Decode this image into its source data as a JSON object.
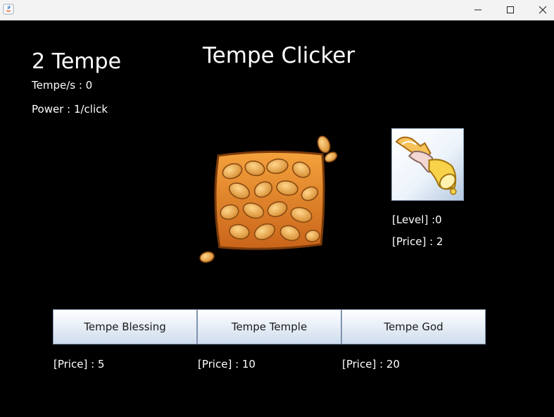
{
  "window": {
    "icon": "java-icon",
    "minimize_icon": "minimize-icon",
    "maximize_icon": "maximize-icon",
    "close_icon": "close-icon"
  },
  "stats": {
    "tempe_count": "2 Tempe",
    "tempe_per_second": "Tempe/s : 0",
    "power": "Power : 1/click"
  },
  "game": {
    "title": "Tempe Clicker",
    "clicker_icon": "tempe-icon"
  },
  "upgrade": {
    "icon": "hand-bell-icon",
    "level": "[Level] :0",
    "price": "[Price] : 2"
  },
  "shop": {
    "items": [
      {
        "label": "Tempe Blessing",
        "price": "[Price] : 5"
      },
      {
        "label": "Tempe Temple",
        "price": "[Price] : 10"
      },
      {
        "label": "Tempe God",
        "price": "[Price] : 20"
      }
    ]
  }
}
